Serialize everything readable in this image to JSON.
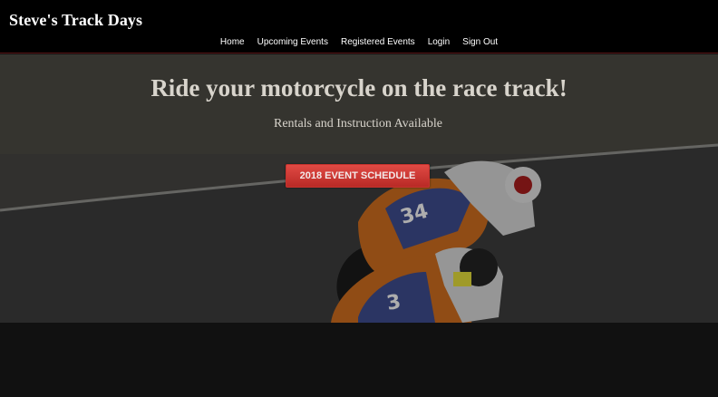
{
  "header": {
    "brand": "Steve's Track Days",
    "nav": {
      "home": "Home",
      "upcoming": "Upcoming Events",
      "registered": "Registered Events",
      "login": "Login",
      "signout": "Sign Out"
    }
  },
  "hero": {
    "title": "Ride your motorcycle on the race track!",
    "subtitle": "Rentals and Instruction Available",
    "cta_label": "2018 EVENT SCHEDULE",
    "bike_numbers": [
      "34",
      "3"
    ]
  },
  "colors": {
    "header_bg": "#000000",
    "cta": "#d0403a",
    "page_bg": "#111111"
  }
}
